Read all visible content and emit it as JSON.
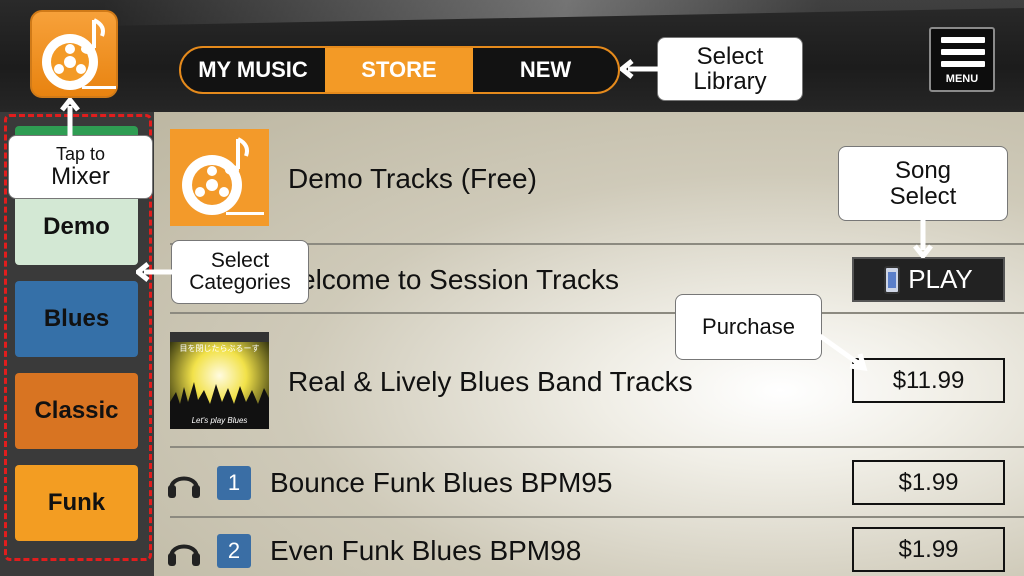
{
  "header": {
    "tabs": [
      {
        "label": "MY MUSIC"
      },
      {
        "label": "STORE"
      },
      {
        "label": "NEW"
      }
    ],
    "menu_label": "MENU"
  },
  "sidebar": {
    "categories": [
      {
        "label": "Demo"
      },
      {
        "label": "Blues"
      },
      {
        "label": "Classic"
      },
      {
        "label": "Funk"
      }
    ]
  },
  "main": {
    "items": [
      {
        "title": "Demo Tracks (Free)"
      },
      {
        "title": "Welcome to Session Tracks",
        "visible_title": "elcome to Session Tracks",
        "action": "PLAY"
      },
      {
        "title": "Real & Lively Blues Band Tracks",
        "price": "$11.99",
        "album_text_1": "目を閉じたらぶるーす",
        "album_text_2": "Let's play Blues"
      },
      {
        "number": "1",
        "title": "Bounce Funk Blues BPM95",
        "price": "$1.99"
      },
      {
        "number": "2",
        "title": "Even Funk Blues BPM98",
        "price": "$1.99"
      }
    ]
  },
  "callouts": {
    "mixer_line1": "Tap to",
    "mixer_line2": "Mixer",
    "library_line1": "Select",
    "library_line2": "Library",
    "categories_line1": "Select",
    "categories_line2": "Categories",
    "song_line1": "Song",
    "song_line2": "Select",
    "purchase": "Purchase"
  },
  "colors": {
    "accent": "#f39a26",
    "demo": "#d3e8d4",
    "blues": "#3570a8",
    "classic": "#d87422",
    "funk": "#f39d22",
    "callout_border_dash": "#e11d1d"
  }
}
